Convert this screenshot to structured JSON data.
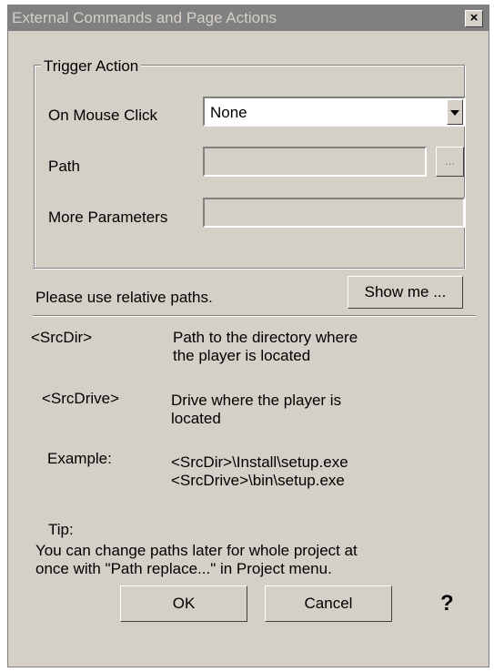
{
  "window": {
    "title": "External Commands and Page Actions",
    "close_label": "×"
  },
  "trigger_group": {
    "legend": "Trigger Action",
    "mouse_click_label": "On Mouse Click",
    "mouse_click_value": "None",
    "path_label": "Path",
    "path_value": "",
    "browse_label": "...",
    "params_label": "More Parameters",
    "params_value": ""
  },
  "hint": {
    "text": "Please use relative paths.",
    "show_me_label": "Show me ..."
  },
  "help_items": [
    {
      "key": "<SrcDir>",
      "desc": "Path to the directory where\nthe player is located"
    },
    {
      "key": "<SrcDrive>",
      "desc": "Drive where the player is\nlocated"
    },
    {
      "key": "Example:",
      "desc": "<SrcDir>\\Install\\setup.exe\n<SrcDrive>\\bin\\setup.exe"
    }
  ],
  "tip": {
    "title": "Tip:",
    "text": "You can change paths later for whole project  at\nonce with \"Path replace...\" in Project menu."
  },
  "buttons": {
    "ok": "OK",
    "cancel": "Cancel",
    "help": "?"
  },
  "colors": {
    "face": "#d4d0c8",
    "titlebar": "#808080",
    "title_text": "#d4d0c8"
  },
  "icons": {
    "close": "close-icon",
    "dropdown": "chevron-down-icon",
    "help": "help-icon"
  }
}
